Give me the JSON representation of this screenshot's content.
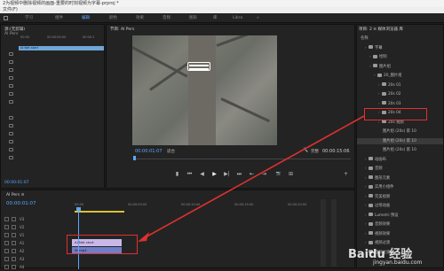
{
  "window": {
    "title": "2为视频中删除视频的画面-重要的时刻视频为字幕-prproj *",
    "menu": "文件(F)"
  },
  "workspaces": [
    {
      "label": "学习",
      "active": false
    },
    {
      "label": "组件",
      "active": false
    },
    {
      "label": "编辑",
      "active": true
    },
    {
      "label": "颜色",
      "active": false
    },
    {
      "label": "效果",
      "active": false
    },
    {
      "label": "音频",
      "active": false
    },
    {
      "label": "图形",
      "active": false
    },
    {
      "label": "库",
      "active": false
    },
    {
      "label": "Libra",
      "active": false
    },
    {
      "label": "»",
      "active": false
    }
  ],
  "source_panel": {
    "title": "源:(无剪辑)",
    "sequence": "AI Pers",
    "ruler": [
      "00:00",
      "00:00:05:00",
      "00:00:1"
    ],
    "clip_label": "AI Net start",
    "timecode": "00:00:01:07"
  },
  "program_panel": {
    "title": "节目: AI Pers",
    "timecode": "00:00:01:07",
    "fit": "适合",
    "full": "完整",
    "duration": "00:00:15:06",
    "controls": [
      "▮",
      "⏮",
      "◀",
      "▶",
      "▶|",
      "⏭",
      "⇤",
      "⇥",
      "📷",
      "⊞",
      "+"
    ]
  },
  "project_panel": {
    "tabs": "项目: 2 ≡  媒体浏览器  库",
    "tree": [
      {
        "label": "名称",
        "depth": 0,
        "selected": false,
        "folder": false
      },
      {
        "label": "字幕",
        "depth": 1,
        "selected": false,
        "folder": true
      },
      {
        "label": "绘制",
        "depth": 2,
        "selected": false,
        "folder": true
      },
      {
        "label": "图片组",
        "depth": 2,
        "selected": false,
        "folder": true
      },
      {
        "label": "20_图片组",
        "depth": 3,
        "selected": false,
        "folder": true
      },
      {
        "label": "20s 01",
        "depth": 4,
        "selected": false,
        "folder": true
      },
      {
        "label": "20s 02",
        "depth": 4,
        "selected": false,
        "folder": true
      },
      {
        "label": "20s 03",
        "depth": 4,
        "selected": false,
        "folder": true
      },
      {
        "label": "20s 04",
        "depth": 4,
        "selected": false,
        "folder": true
      },
      {
        "label": "20s 视频",
        "depth": 4,
        "selected": false,
        "folder": true
      },
      {
        "label": "图片组 (20s) 第 10",
        "depth": 5,
        "selected": false,
        "folder": false
      },
      {
        "label": "图片组 (20s) 第 10",
        "depth": 5,
        "selected": true,
        "folder": false
      },
      {
        "label": "图片组 (20s) 第 10",
        "depth": 5,
        "selected": false,
        "folder": false
      },
      {
        "label": "动画布",
        "depth": 1,
        "selected": false,
        "folder": true
      },
      {
        "label": "音频",
        "depth": 1,
        "selected": false,
        "folder": true
      },
      {
        "label": "图形元素",
        "depth": 1,
        "selected": false,
        "folder": true
      },
      {
        "label": "实用小组件",
        "depth": 1,
        "selected": false,
        "folder": true
      },
      {
        "label": "完美视频",
        "depth": 1,
        "selected": false,
        "folder": true
      },
      {
        "label": "过场动画",
        "depth": 1,
        "selected": false,
        "folder": true
      },
      {
        "label": "Lumetri 预设",
        "depth": 1,
        "selected": false,
        "folder": true
      },
      {
        "label": "音频效果",
        "depth": 1,
        "selected": false,
        "folder": true
      },
      {
        "label": "视频效果",
        "depth": 1,
        "selected": false,
        "folder": true
      },
      {
        "label": "视频过渡",
        "depth": 1,
        "selected": false,
        "folder": true
      },
      {
        "label": "音频过渡",
        "depth": 1,
        "selected": false,
        "folder": true
      }
    ]
  },
  "timeline": {
    "title": "AI Pers ≡",
    "timecode": "00:00:01:07",
    "ruler": [
      "00:00",
      "00:00:05:00",
      "00:00:10:00",
      "00:00:15:00",
      "00:00:20:00"
    ],
    "tracks": [
      "V3",
      "V2",
      "V1",
      "A1",
      "A2",
      "A3",
      "A4"
    ],
    "clip_title": "AI Net start",
    "clip_video": "9t.mp4"
  },
  "watermark": {
    "brand": "Baidu 经验",
    "url": "jingyan.baidu.com"
  },
  "colors": {
    "accent": "#5aa7ff",
    "annotation": "#e03030",
    "title_clip": "#c9b8e6",
    "video_clip": "#6f7ec8"
  }
}
